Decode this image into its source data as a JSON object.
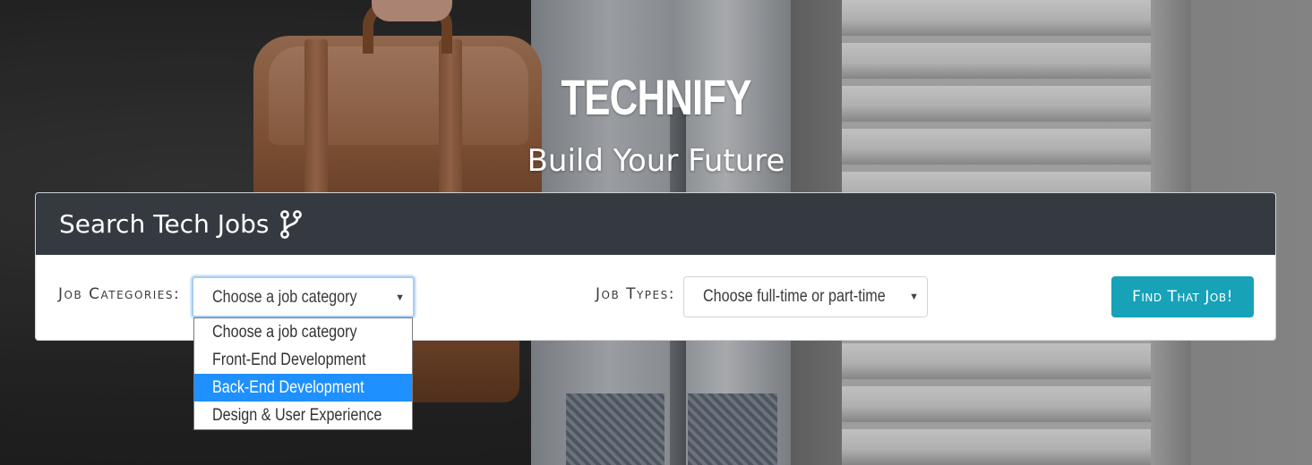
{
  "hero": {
    "brand": "TECHNIFY",
    "tagline": "Build Your Future"
  },
  "search": {
    "title": "Search Tech Jobs",
    "title_icon": "code-branch-icon",
    "categories_label": "Job Categories:",
    "categories_value": "Choose a job category",
    "types_label": "Job Types:",
    "types_value": "Choose full-time or part-time",
    "button_label": "Find That Job!",
    "dropdown_caret": "▼"
  },
  "dropdown": {
    "options": [
      {
        "label": "Choose a job category"
      },
      {
        "label": "Front-End Development"
      },
      {
        "label": "Back-End Development",
        "highlighted": true
      },
      {
        "label": "Design & User Experience"
      }
    ]
  },
  "colors": {
    "header_bg": "#343a40",
    "button_bg": "#17a2b8",
    "highlight": "#1e90ff"
  }
}
